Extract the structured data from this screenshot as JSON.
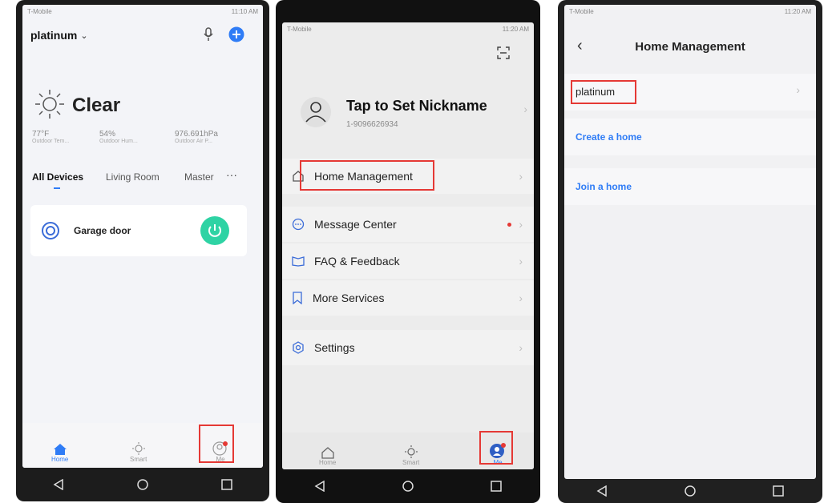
{
  "screen1": {
    "status": {
      "carrier": "T-Mobile",
      "time": "11:10 AM"
    },
    "home_name": "platinum",
    "weather": {
      "condition": "Clear",
      "stats": [
        {
          "value": "77°F",
          "label": "Outdoor Tem..."
        },
        {
          "value": "54%",
          "label": "Outdoor Hum..."
        },
        {
          "value": "976.691hPa",
          "label": "Outdoor Air P..."
        }
      ]
    },
    "tabs": [
      "All Devices",
      "Living Room",
      "Master"
    ],
    "device": {
      "name": "Garage door"
    },
    "tabbar": {
      "home": "Home",
      "smart": "Smart",
      "me": "Me"
    },
    "colors": {
      "accent": "#2f7cf6",
      "power": "#2ed3a4",
      "highlight": "#e53935"
    }
  },
  "screen2": {
    "status": {
      "carrier": "T-Mobile",
      "time": "11:20 AM"
    },
    "profile": {
      "nickname": "Tap to Set Nickname",
      "phone": "1-9096626934"
    },
    "menu": {
      "home_management": "Home Management",
      "message_center": "Message Center",
      "faq": "FAQ & Feedback",
      "more_services": "More Services",
      "settings": "Settings"
    },
    "tabbar": {
      "home": "Home",
      "smart": "Smart",
      "me": "Me"
    }
  },
  "screen3": {
    "status": {
      "carrier": "T-Mobile",
      "time": "11:20 AM"
    },
    "title": "Home Management",
    "home_item": "platinum",
    "create": "Create a home",
    "join": "Join a home"
  }
}
